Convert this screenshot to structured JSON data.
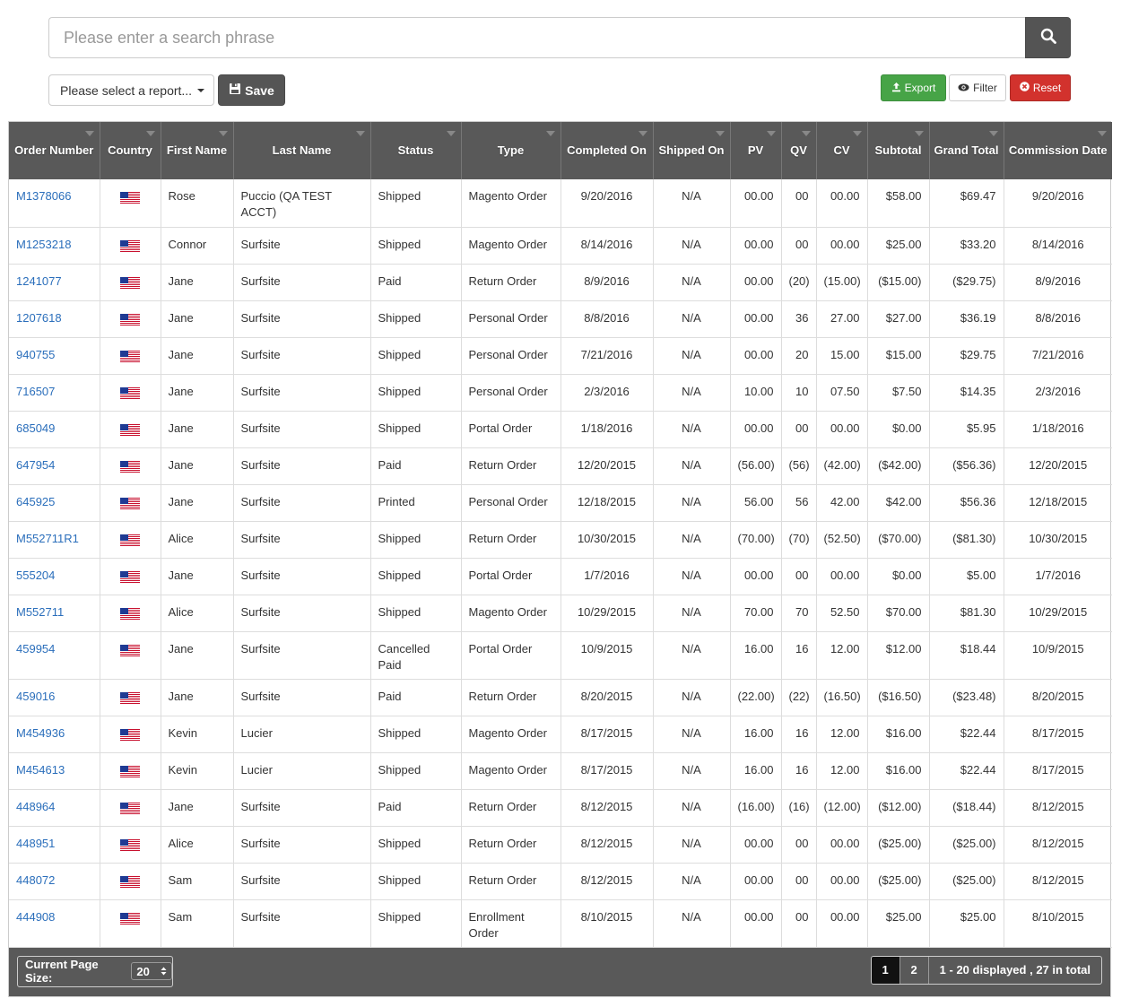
{
  "search": {
    "placeholder": "Please enter a search phrase",
    "icon": "search-icon"
  },
  "toolbar": {
    "report_select": "Please select a report...",
    "save_label": "Save",
    "export_label": "Export",
    "filter_label": "Filter",
    "reset_label": "Reset"
  },
  "colors": {
    "header_bg": "#595959",
    "link": "#2a6ebb",
    "export": "#47a447",
    "reset": "#d2322d"
  },
  "table": {
    "columns": [
      "Order Number",
      "Country",
      "First Name",
      "Last Name",
      "Status",
      "Type",
      "Completed On",
      "Shipped On",
      "PV",
      "QV",
      "CV",
      "Subtotal",
      "Grand Total",
      "Commission Date"
    ],
    "rows": [
      [
        "M1378066",
        "US",
        "Rose",
        "Puccio (QA TEST ACCT)",
        "Shipped",
        "Magento Order",
        "9/20/2016",
        "N/A",
        "00.00",
        "00",
        "00.00",
        "$58.00",
        "$69.47",
        "9/20/2016"
      ],
      [
        "M1253218",
        "US",
        "Connor",
        "Surfsite",
        "Shipped",
        "Magento Order",
        "8/14/2016",
        "N/A",
        "00.00",
        "00",
        "00.00",
        "$25.00",
        "$33.20",
        "8/14/2016"
      ],
      [
        "1241077",
        "US",
        "Jane",
        "Surfsite",
        "Paid",
        "Return Order",
        "8/9/2016",
        "N/A",
        "00.00",
        "(20)",
        "(15.00)",
        "($15.00)",
        "($29.75)",
        "8/9/2016"
      ],
      [
        "1207618",
        "US",
        "Jane",
        "Surfsite",
        "Shipped",
        "Personal Order",
        "8/8/2016",
        "N/A",
        "00.00",
        "36",
        "27.00",
        "$27.00",
        "$36.19",
        "8/8/2016"
      ],
      [
        "940755",
        "US",
        "Jane",
        "Surfsite",
        "Shipped",
        "Personal Order",
        "7/21/2016",
        "N/A",
        "00.00",
        "20",
        "15.00",
        "$15.00",
        "$29.75",
        "7/21/2016"
      ],
      [
        "716507",
        "US",
        "Jane",
        "Surfsite",
        "Shipped",
        "Personal Order",
        "2/3/2016",
        "N/A",
        "10.00",
        "10",
        "07.50",
        "$7.50",
        "$14.35",
        "2/3/2016"
      ],
      [
        "685049",
        "US",
        "Jane",
        "Surfsite",
        "Shipped",
        "Portal Order",
        "1/18/2016",
        "N/A",
        "00.00",
        "00",
        "00.00",
        "$0.00",
        "$5.95",
        "1/18/2016"
      ],
      [
        "647954",
        "US",
        "Jane",
        "Surfsite",
        "Paid",
        "Return Order",
        "12/20/2015",
        "N/A",
        "(56.00)",
        "(56)",
        "(42.00)",
        "($42.00)",
        "($56.36)",
        "12/20/2015"
      ],
      [
        "645925",
        "US",
        "Jane",
        "Surfsite",
        "Printed",
        "Personal Order",
        "12/18/2015",
        "N/A",
        "56.00",
        "56",
        "42.00",
        "$42.00",
        "$56.36",
        "12/18/2015"
      ],
      [
        "M552711R1",
        "US",
        "Alice",
        "Surfsite",
        "Shipped",
        "Return Order",
        "10/30/2015",
        "N/A",
        "(70.00)",
        "(70)",
        "(52.50)",
        "($70.00)",
        "($81.30)",
        "10/30/2015"
      ],
      [
        "555204",
        "US",
        "Jane",
        "Surfsite",
        "Shipped",
        "Portal Order",
        "1/7/2016",
        "N/A",
        "00.00",
        "00",
        "00.00",
        "$0.00",
        "$5.00",
        "1/7/2016"
      ],
      [
        "M552711",
        "US",
        "Alice",
        "Surfsite",
        "Shipped",
        "Magento Order",
        "10/29/2015",
        "N/A",
        "70.00",
        "70",
        "52.50",
        "$70.00",
        "$81.30",
        "10/29/2015"
      ],
      [
        "459954",
        "US",
        "Jane",
        "Surfsite",
        "Cancelled Paid",
        "Portal Order",
        "10/9/2015",
        "N/A",
        "16.00",
        "16",
        "12.00",
        "$12.00",
        "$18.44",
        "10/9/2015"
      ],
      [
        "459016",
        "US",
        "Jane",
        "Surfsite",
        "Paid",
        "Return Order",
        "8/20/2015",
        "N/A",
        "(22.00)",
        "(22)",
        "(16.50)",
        "($16.50)",
        "($23.48)",
        "8/20/2015"
      ],
      [
        "M454936",
        "US",
        "Kevin",
        "Lucier",
        "Shipped",
        "Magento Order",
        "8/17/2015",
        "N/A",
        "16.00",
        "16",
        "12.00",
        "$16.00",
        "$22.44",
        "8/17/2015"
      ],
      [
        "M454613",
        "US",
        "Kevin",
        "Lucier",
        "Shipped",
        "Magento Order",
        "8/17/2015",
        "N/A",
        "16.00",
        "16",
        "12.00",
        "$16.00",
        "$22.44",
        "8/17/2015"
      ],
      [
        "448964",
        "US",
        "Jane",
        "Surfsite",
        "Paid",
        "Return Order",
        "8/12/2015",
        "N/A",
        "(16.00)",
        "(16)",
        "(12.00)",
        "($12.00)",
        "($18.44)",
        "8/12/2015"
      ],
      [
        "448951",
        "US",
        "Alice",
        "Surfsite",
        "Shipped",
        "Return Order",
        "8/12/2015",
        "N/A",
        "00.00",
        "00",
        "00.00",
        "($25.00)",
        "($25.00)",
        "8/12/2015"
      ],
      [
        "448072",
        "US",
        "Sam",
        "Surfsite",
        "Shipped",
        "Return Order",
        "8/12/2015",
        "N/A",
        "00.00",
        "00",
        "00.00",
        "($25.00)",
        "($25.00)",
        "8/12/2015"
      ],
      [
        "444908",
        "US",
        "Sam",
        "Surfsite",
        "Shipped",
        "Enrollment Order",
        "8/10/2015",
        "N/A",
        "00.00",
        "00",
        "00.00",
        "$25.00",
        "$25.00",
        "8/10/2015"
      ]
    ]
  },
  "footer": {
    "page_size_label": "Current Page Size:",
    "page_size_value": "20",
    "pages": [
      "1",
      "2"
    ],
    "active_page": "1",
    "summary": "1 - 20 displayed , 27 in total"
  }
}
